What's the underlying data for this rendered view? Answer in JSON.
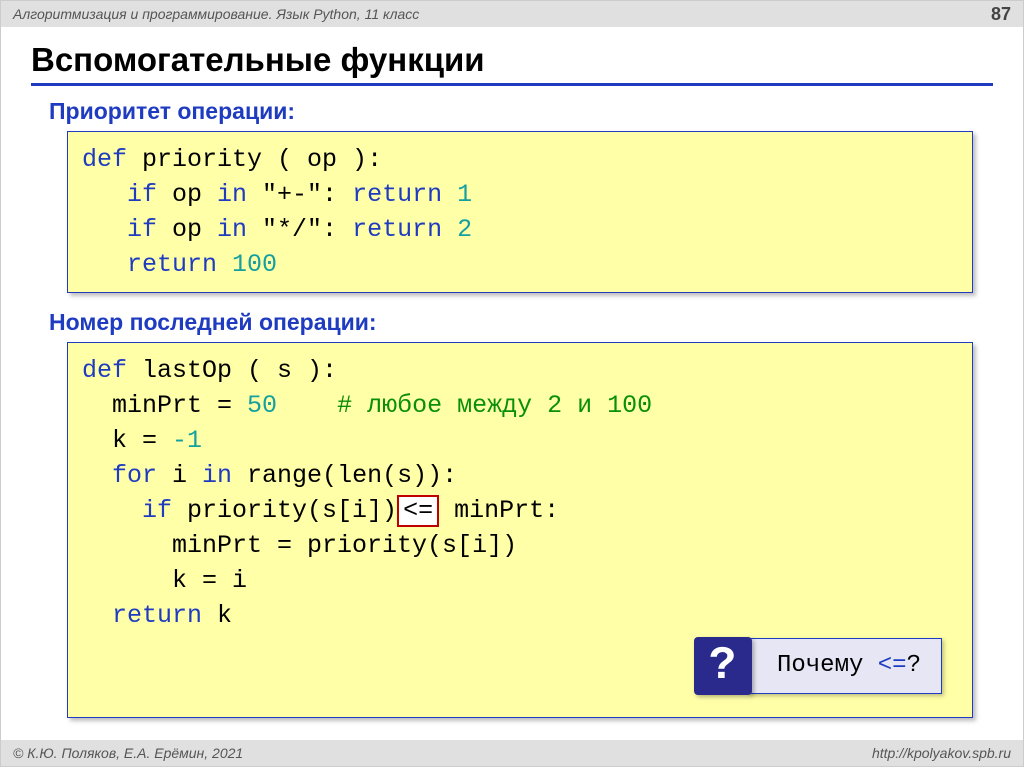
{
  "header": {
    "course": "Алгоритмизация и программирование. Язык Python, 11 класс",
    "page": "87"
  },
  "title": "Вспомогательные функции",
  "section1": {
    "heading": "Приоритет операции:",
    "code": {
      "l1_def": "def",
      "l1_name": " priority",
      "l1_paren": " ( op ):",
      "l2_if": "   if",
      "l2_body": " op ",
      "l2_in": "in",
      "l2_str": " \"+-\": ",
      "l2_ret": "return",
      "l2_num": " 1",
      "l3_if": "   if",
      "l3_body": " op ",
      "l3_in": "in",
      "l3_str": " \"*/\": ",
      "l3_ret": "return",
      "l3_num": " 2",
      "l4_ret": "   return",
      "l4_num": " 100"
    }
  },
  "section2": {
    "heading": "Номер последней операции:",
    "code": {
      "l1_def": "def",
      "l1_name": " lastOp",
      "l1_paren": " ( s ):",
      "l2_var": "  minPrt",
      "l2_eq": " = ",
      "l2_num": "50",
      "l2_comment": "    # любое между 2 и 100",
      "l3_var": "  k",
      "l3_eq": " = ",
      "l3_num": "-1",
      "l4_for": "  for",
      "l4_body1": " i ",
      "l4_in": "in",
      "l4_body2": " range(len(s)):",
      "l5_if": "    if",
      "l5_body1": " priority(s[i])",
      "l5_op": "<=",
      "l5_body2": " minPrt:",
      "l6": "      minPrt = priority(s[i])",
      "l7": "      k = i",
      "l8_ret": "  return",
      "l8_body": " k"
    }
  },
  "callout": {
    "mark": "?",
    "text_pre": " Почему ",
    "op": "<=",
    "text_post": "?"
  },
  "footer": {
    "left": "© К.Ю. Поляков, Е.А. Ерёмин, 2021",
    "right": "http://kpolyakov.spb.ru"
  }
}
